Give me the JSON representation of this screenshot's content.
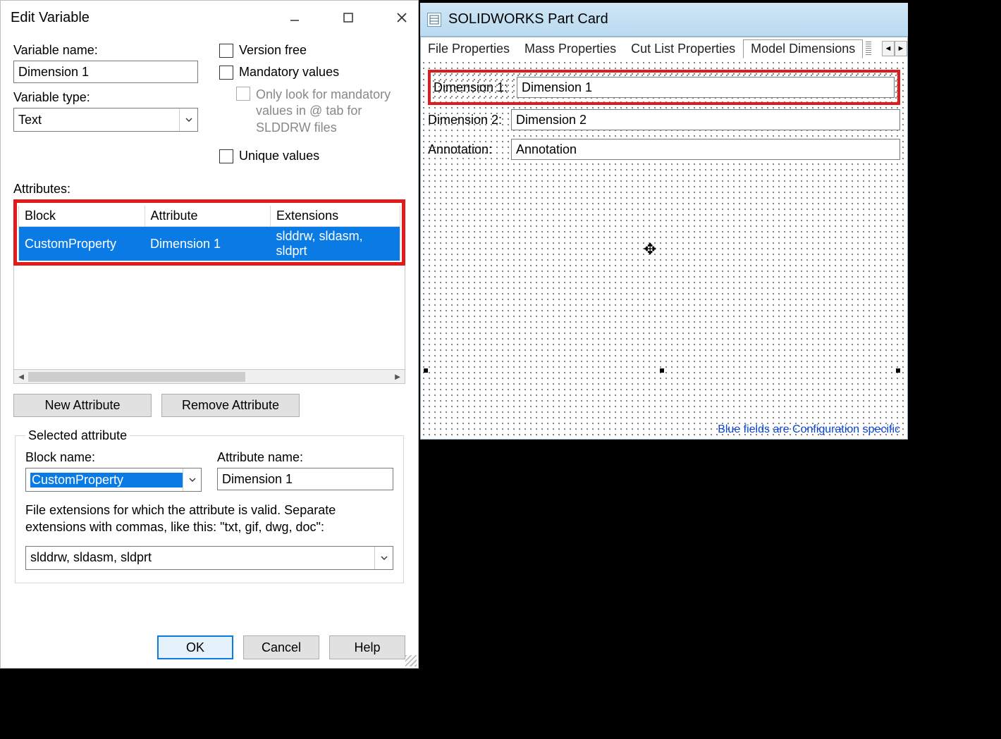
{
  "dialog": {
    "title": "Edit Variable",
    "variable_name_label": "Variable name:",
    "variable_name_value": "Dimension 1",
    "variable_type_label": "Variable type:",
    "variable_type_value": "Text",
    "version_free_label": "Version free",
    "mandatory_values_label": "Mandatory values",
    "mandatory_subnote": "Only look for mandatory values in @ tab for SLDDRW files",
    "unique_values_label": "Unique values",
    "attributes_label": "Attributes:",
    "columns": {
      "block": "Block",
      "attribute": "Attribute",
      "extensions": "Extensions"
    },
    "rows": [
      {
        "block": "CustomProperty",
        "attribute": "Dimension 1",
        "extensions": "slddrw, sldasm, sldprt"
      }
    ],
    "new_attribute_btn": "New Attribute",
    "remove_attribute_btn": "Remove Attribute",
    "selected_attribute_legend": "Selected attribute",
    "block_name_label": "Block name:",
    "block_name_value": "CustomProperty",
    "attribute_name_label": "Attribute name:",
    "attribute_name_value": "Dimension 1",
    "extensions_note": "File extensions for which the attribute is valid. Separate extensions with commas, like this: \"txt, gif, dwg, doc\":",
    "extensions_value": "slddrw, sldasm, sldprt",
    "ok_btn": "OK",
    "cancel_btn": "Cancel",
    "help_btn": "Help"
  },
  "card": {
    "title": "SOLIDWORKS Part Card",
    "tabs": [
      "File Properties",
      "Mass Properties",
      "Cut List Properties",
      "Model Dimensions"
    ],
    "active_tab_index": 3,
    "fields": [
      {
        "label": "Dimension 1:",
        "value": "Dimension 1",
        "highlight": true
      },
      {
        "label": "Dimension 2:",
        "value": "Dimension 2",
        "highlight": false
      },
      {
        "label": "Annotation:",
        "value": "Annotation",
        "highlight": false
      }
    ],
    "config_note": "Blue fields are Configuration specific"
  }
}
